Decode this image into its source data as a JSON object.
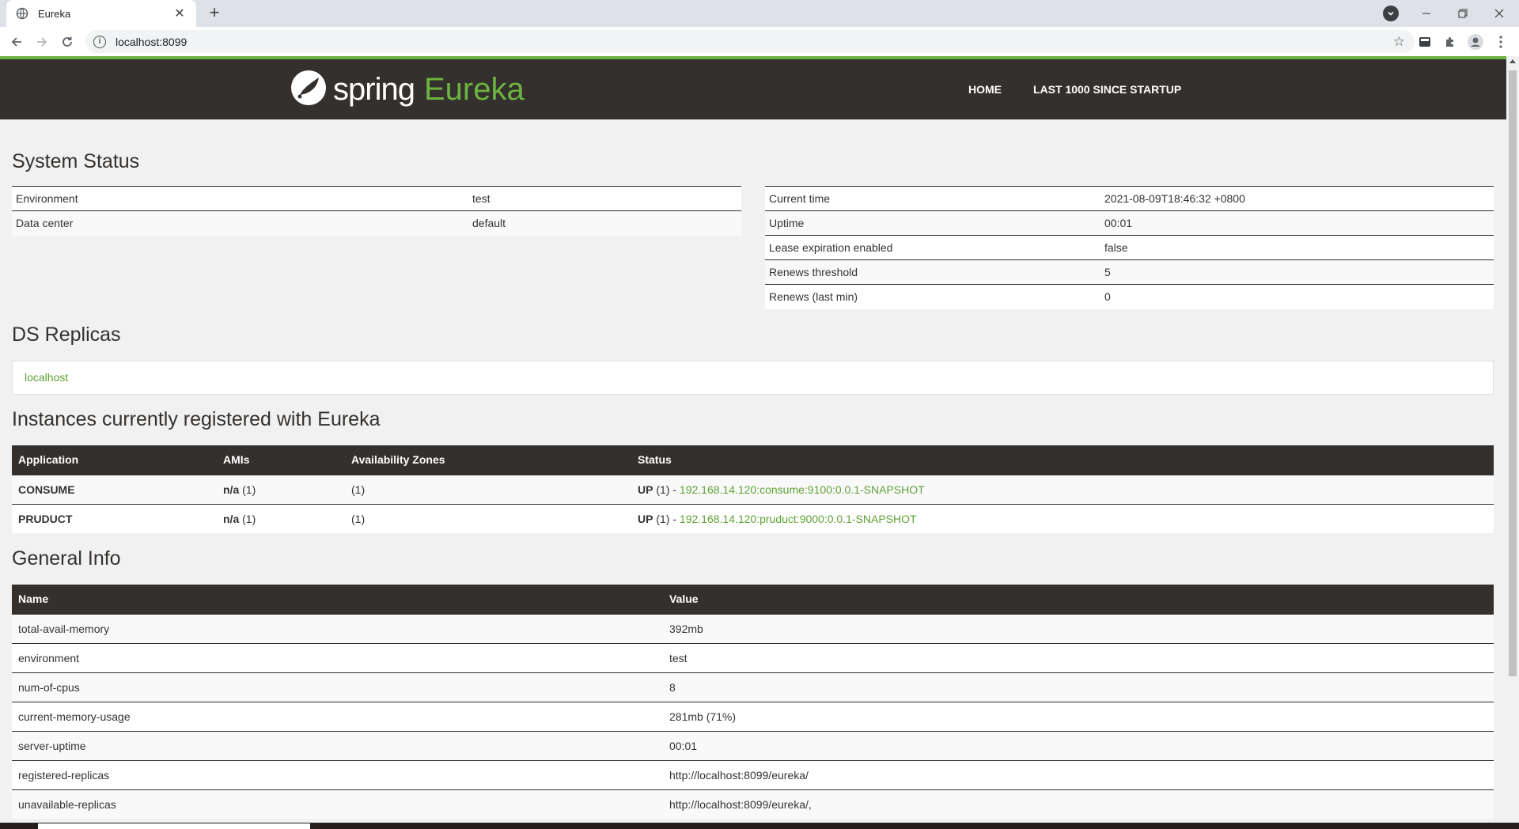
{
  "browser": {
    "tab_title": "Eureka",
    "url": "localhost:8099",
    "new_tab": "+",
    "close_tab": "✕"
  },
  "header": {
    "logo_word1": "spring",
    "logo_word2": "Eureka",
    "nav": [
      "HOME",
      "LAST 1000 SINCE STARTUP"
    ]
  },
  "system_status": {
    "title": "System Status",
    "left": [
      {
        "label": "Environment",
        "value": "test"
      },
      {
        "label": "Data center",
        "value": "default"
      }
    ],
    "right": [
      {
        "label": "Current time",
        "value": "2021-08-09T18:46:32 +0800"
      },
      {
        "label": "Uptime",
        "value": "00:01"
      },
      {
        "label": "Lease expiration enabled",
        "value": "false"
      },
      {
        "label": "Renews threshold",
        "value": "5"
      },
      {
        "label": "Renews (last min)",
        "value": "0"
      }
    ]
  },
  "ds_replicas": {
    "title": "DS Replicas",
    "items": [
      "localhost"
    ]
  },
  "instances": {
    "title": "Instances currently registered with Eureka",
    "headers": [
      "Application",
      "AMIs",
      "Availability Zones",
      "Status"
    ],
    "rows": [
      {
        "application": "CONSUME",
        "ami_bold": "n/a",
        "ami_count": " (1)",
        "zones": "(1)",
        "status_prefix": "UP",
        "status_count": " (1) - ",
        "status_link": "192.168.14.120:consume:9100:0.0.1-SNAPSHOT"
      },
      {
        "application": "PRUDUCT",
        "ami_bold": "n/a",
        "ami_count": " (1)",
        "zones": "(1)",
        "status_prefix": "UP",
        "status_count": " (1) - ",
        "status_link": "192.168.14.120:pruduct:9000:0.0.1-SNAPSHOT"
      }
    ]
  },
  "general_info": {
    "title": "General Info",
    "headers": [
      "Name",
      "Value"
    ],
    "rows": [
      {
        "name": "total-avail-memory",
        "value": "392mb"
      },
      {
        "name": "environment",
        "value": "test"
      },
      {
        "name": "num-of-cpus",
        "value": "8"
      },
      {
        "name": "current-memory-usage",
        "value": "281mb (71%)"
      },
      {
        "name": "server-uptime",
        "value": "00:01"
      },
      {
        "name": "registered-replicas",
        "value": "http://localhost:8099/eureka/"
      },
      {
        "name": "unavailable-replicas",
        "value": "http://localhost:8099/eureka/,"
      }
    ]
  },
  "colors": {
    "brand_green": "#6db33f",
    "header_dark": "#34302d",
    "link_green": "#5fa134"
  },
  "icons": [
    "globe-icon",
    "back-arrow-icon",
    "forward-arrow-icon",
    "reload-icon",
    "info-icon",
    "bookmark-star-icon",
    "extension-puzzle-icon",
    "profile-avatar-icon",
    "kebab-menu-icon",
    "spring-leaf-logo-icon"
  ]
}
